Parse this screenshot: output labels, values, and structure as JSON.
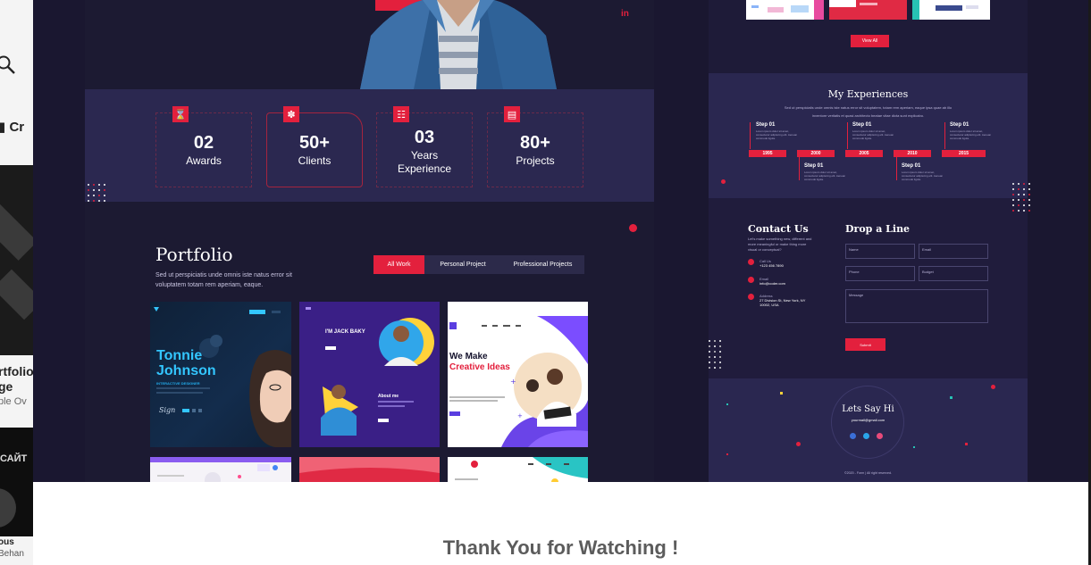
{
  "background": {
    "left_title_partial": "Cr",
    "left_text_1": "rtfolio",
    "left_text_2": "ge",
    "left_text_3": "ple Ov",
    "left_text_cyrillic": "САЙТ",
    "left_text_4": "ous",
    "left_text_5": "Behan"
  },
  "hero": {
    "social_icon": "in"
  },
  "stats": [
    {
      "icon": "hourglass-icon",
      "number": "02",
      "label": "Awards"
    },
    {
      "icon": "handshake-icon",
      "number": "50+",
      "label": "Clients"
    },
    {
      "icon": "calendar-icon",
      "number": "03",
      "label": "Years\nExperience"
    },
    {
      "icon": "clipboard-icon",
      "number": "80+",
      "label": "Projects"
    }
  ],
  "portfolio": {
    "title": "Portfolio",
    "description": "Sed ut perspiciatis unde omnis iste natus error sit voluptatem  totam rem aperiam, eaque.",
    "tabs": [
      "All Work",
      "Personal Project",
      "Professional Projects"
    ],
    "active_tab": "All Work",
    "thumb_1_name": "Tonnie\nJohnson",
    "thumb_1_sub": "INTERACTIVE DESIGNER",
    "thumb_2_name": "I'M JACK BAKY",
    "thumb_2_about": "About me",
    "thumb_3_head_1": "We Make",
    "thumb_3_head_2": "Creative Ideas"
  },
  "right_top": {
    "view_all": "View All"
  },
  "experiences": {
    "title": "My Experiences",
    "description": "Sed ut perspiciatis unde omnis iste natus error sit voluptatem, totam rem aperiam, eaque ipsa quae ab illo inventore veritatis et quasi architecto beatae vitae dicta sunt explicabo.",
    "years": [
      "1995",
      "2000",
      "2005",
      "2010",
      "2015"
    ],
    "step_label": "Step 01",
    "step_text": "Lorem ipsum dolor sit amet, consectetur adipiscing elit. Aenean commodo ligula."
  },
  "contact": {
    "title": "Contact Us",
    "description": "Let's make something new, different and more meaningful or make thing more visual or conceptual?",
    "call_label": "Call Us",
    "phone": "+123 456 7890",
    "email_label": "Email",
    "email": "info@coder.com",
    "address_label": "Address",
    "address": "27 Division St, New York, NY 10002, USA"
  },
  "drop_a_line": {
    "title": "Drop a Line",
    "fields": [
      "Name",
      "Email",
      "Phone",
      "Budget"
    ],
    "message_placeholder": "Message",
    "submit": "Submit"
  },
  "say_hi": {
    "title": "Lets Say Hi",
    "email": "yourmail@gmail.com",
    "copyright": "©2020 - Form  |   All right reserved."
  },
  "footer": {
    "thanks": "Thank You for Watching !"
  },
  "colors": {
    "accent": "#e3203d",
    "dark_bg": "#1c1a32",
    "band_bg": "#2b2850"
  }
}
